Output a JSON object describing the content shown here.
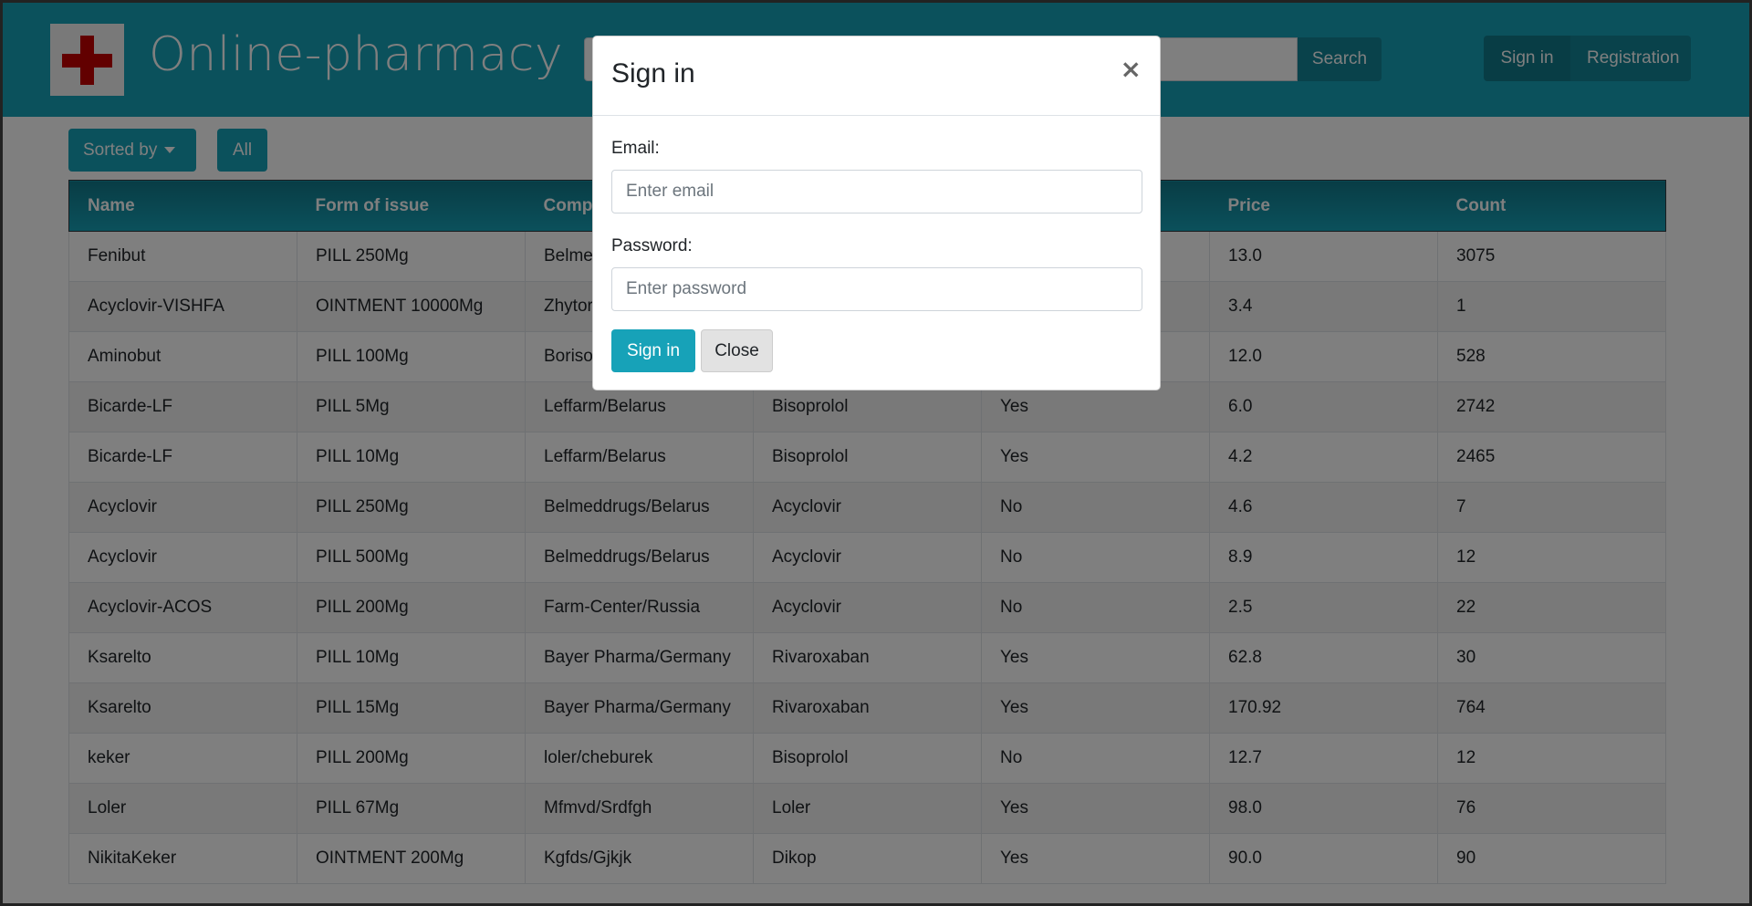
{
  "header": {
    "brand": "Online-pharmacy",
    "search_button": "Search",
    "sign_in": "Sign in",
    "registration": "Registration"
  },
  "filters": {
    "sorted_by": "Sorted by",
    "all": "All"
  },
  "table": {
    "columns": [
      "Name",
      "Form of issue",
      "Comp",
      "",
      "",
      "Price",
      "Count"
    ],
    "rows": [
      [
        "Fenibut",
        "PILL 250Mg",
        "Belme",
        "",
        "",
        "13.0",
        "3075"
      ],
      [
        "Acyclovir-VISHFA",
        "OINTMENT 10000Mg",
        "Zhytor",
        "",
        "",
        "3.4",
        "1"
      ],
      [
        "Aminobut",
        "PILL 100Mg",
        "Boriso",
        "",
        "",
        "12.0",
        "528"
      ],
      [
        "Bicarde-LF",
        "PILL 5Mg",
        "Leffarm/Belarus",
        "Bisoprolol",
        "Yes",
        "6.0",
        "2742"
      ],
      [
        "Bicarde-LF",
        "PILL 10Mg",
        "Leffarm/Belarus",
        "Bisoprolol",
        "Yes",
        "4.2",
        "2465"
      ],
      [
        "Acyclovir",
        "PILL 250Mg",
        "Belmeddrugs/Belarus",
        "Acyclovir",
        "No",
        "4.6",
        "7"
      ],
      [
        "Acyclovir",
        "PILL 500Mg",
        "Belmeddrugs/Belarus",
        "Acyclovir",
        "No",
        "8.9",
        "12"
      ],
      [
        "Acyclovir-ACOS",
        "PILL 200Mg",
        "Farm-Center/Russia",
        "Acyclovir",
        "No",
        "2.5",
        "22"
      ],
      [
        "Ksarelto",
        "PILL 10Mg",
        "Bayer Pharma/Germany",
        "Rivaroxaban",
        "Yes",
        "62.8",
        "30"
      ],
      [
        "Ksarelto",
        "PILL 15Mg",
        "Bayer Pharma/Germany",
        "Rivaroxaban",
        "Yes",
        "170.92",
        "764"
      ],
      [
        "keker",
        "PILL 200Mg",
        "loler/cheburek",
        "Bisoprolol",
        "No",
        "12.7",
        "12"
      ],
      [
        "Loler",
        "PILL 67Mg",
        "Mfmvd/Srdfgh",
        "Loler",
        "Yes",
        "98.0",
        "76"
      ],
      [
        "NikitaKeker",
        "OINTMENT 200Mg",
        "Kgfds/Gjkjk",
        "Dikop",
        "Yes",
        "90.0",
        "90"
      ]
    ]
  },
  "modal": {
    "title": "Sign in",
    "close_symbol": "×",
    "email_label": "Email:",
    "email_placeholder": "Enter email",
    "password_label": "Password:",
    "password_placeholder": "Enter password",
    "submit": "Sign in",
    "close": "Close"
  },
  "colors": {
    "accent": "#17a2b8",
    "accent_dark": "#138496",
    "logo_cross": "#c40000"
  },
  "icons": {
    "logo": "red-cross-icon",
    "close": "close-icon",
    "caret": "caret-down-icon"
  }
}
